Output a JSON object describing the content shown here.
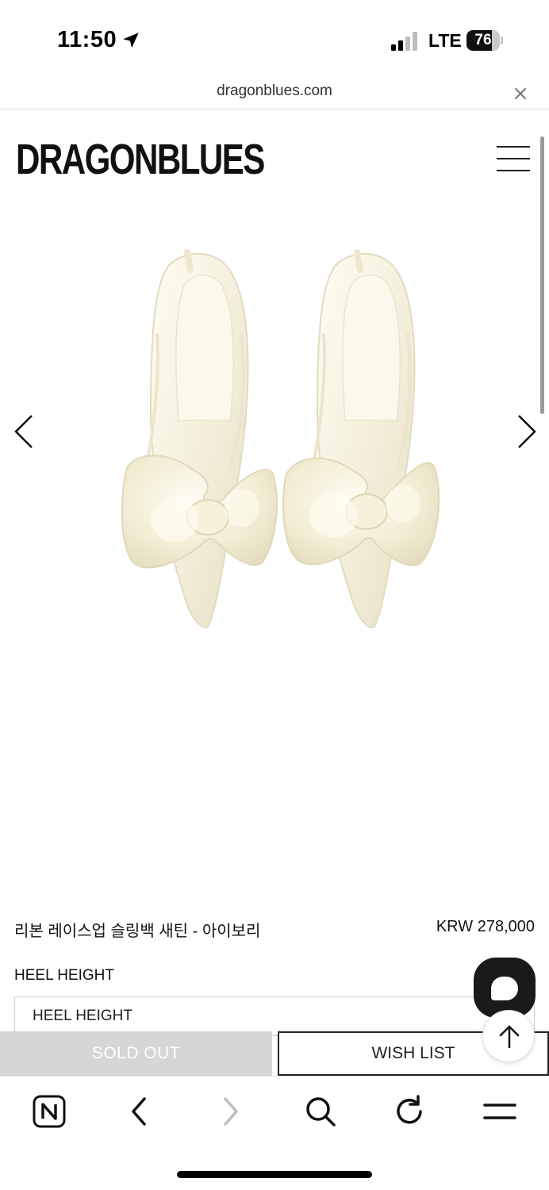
{
  "status_bar": {
    "time": "11:50",
    "network": "LTE",
    "battery_percent": 76,
    "battery_label": "76",
    "icons": [
      "location-arrow-icon",
      "signal-icon",
      "battery-icon"
    ]
  },
  "browser": {
    "url": "dragonblues.com",
    "close_icon": "close-icon"
  },
  "header": {
    "brand": "DRAGONBLUES",
    "menu_icon": "hamburger-menu-icon"
  },
  "gallery": {
    "image_subject": "ivory satin slingback heels with large bows",
    "prev_icon": "chevron-left-icon",
    "next_icon": "chevron-right-icon"
  },
  "product": {
    "name": "리본 레이스업 슬링백 새틴 - 아이보리",
    "price": "KRW 278,000",
    "option_label": "HEEL HEIGHT",
    "option_select_value": "HEEL HEIGHT"
  },
  "actions": {
    "sold_out": "SOLD OUT",
    "wish_list": "WISH LIST"
  },
  "floating": {
    "chat_icon": "chat-bubble-icon",
    "top_icon": "arrow-up-icon"
  },
  "toolbar": {
    "icons": [
      "naver-home-icon",
      "back-arrow-icon",
      "forward-arrow-icon",
      "search-icon",
      "refresh-icon",
      "menu-icon"
    ]
  },
  "colors": {
    "sold_out_bg": "#d6d6d6",
    "chat_bg": "#1a1a1a",
    "text": "#111111"
  }
}
